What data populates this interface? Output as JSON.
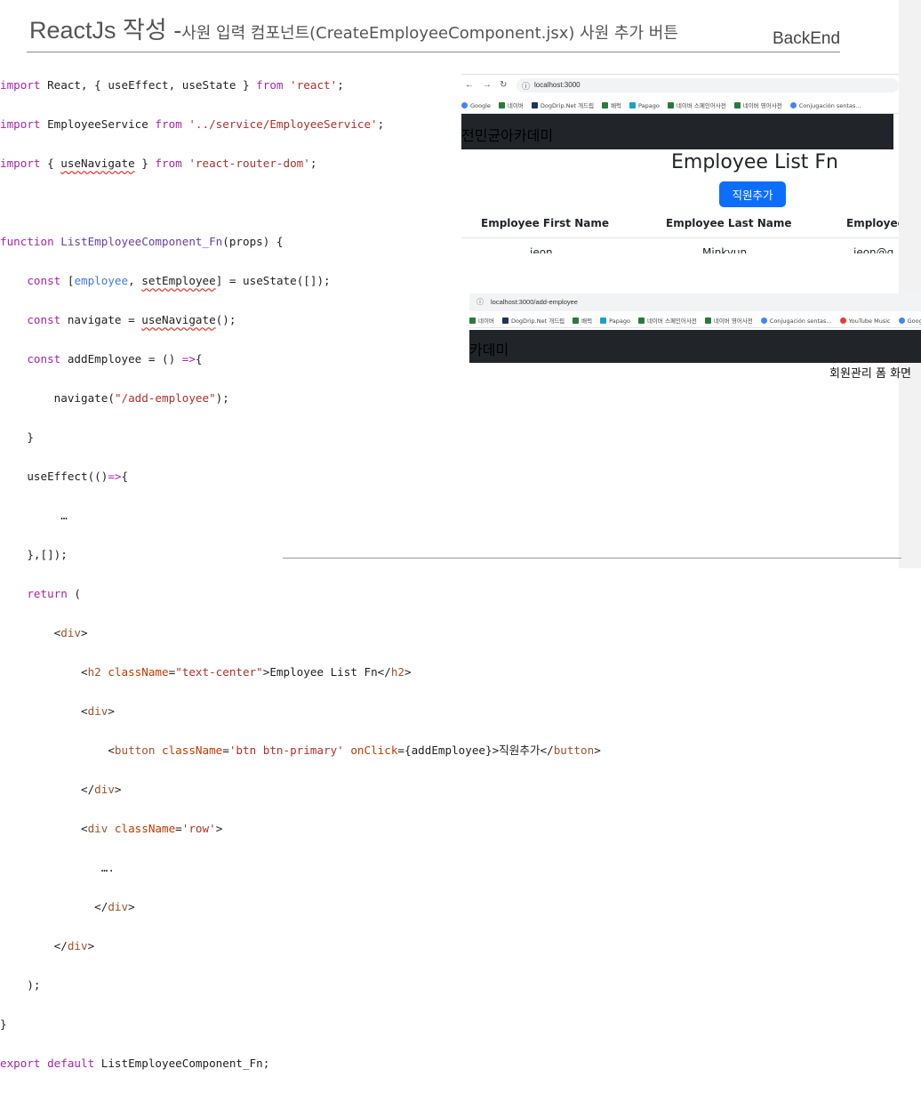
{
  "slide": {
    "title_main": "ReactJs 작성 -",
    "title_sub": "사원 입력 컴포넌트(CreateEmployeeComponent.jsx) 사원 추가 버튼",
    "section_label": "BackEnd",
    "caption": "회원관리 폼 화면"
  },
  "code": {
    "l1": {
      "a": "import",
      "b": " React, { ",
      "c": "useEffect",
      "d": ", ",
      "e": "useState",
      "f": " } ",
      "g": "from",
      "h": " ",
      "i": "'react'",
      "j": ";"
    },
    "l2": {
      "a": "import",
      "b": " EmployeeService ",
      "c": "from",
      "d": " ",
      "e": "'../service/EmployeeService'",
      "f": ";"
    },
    "l3": {
      "a": "import",
      "b": " { ",
      "c": "useNavigate",
      "d": " } ",
      "e": "from",
      "f": " ",
      "g": "'react-router-dom'",
      "h": ";"
    },
    "l5": {
      "a": "function",
      "b": " ",
      "c": "ListEmployeeComponent_Fn",
      "d": "(props) {"
    },
    "l6": {
      "a": "    ",
      "b": "const",
      "c": " [",
      "d": "employee",
      "e": ", ",
      "f": "setEmployee",
      "g": "] = ",
      "h": "useState",
      "i": "([]);"
    },
    "l7": {
      "a": "    ",
      "b": "const",
      "c": " navigate = ",
      "d": "useNavigate",
      "e": "();"
    },
    "l8": {
      "a": "    ",
      "b": "const",
      "c": " addEmployee = () ",
      "d": "=>",
      "e": "{"
    },
    "l9": {
      "a": "        ",
      "b": "navigate",
      "c": "(",
      "d": "\"/add-employee\"",
      "e": ");"
    },
    "l10": {
      "a": "    }"
    },
    "l11": {
      "a": "    ",
      "b": "useEffect",
      "c": "(()",
      "d": "=>",
      "e": "{"
    },
    "l12": {
      "a": "         …"
    },
    "l13": {
      "a": "    },[]);"
    },
    "l14": {
      "a": "    ",
      "b": "return",
      "c": " ("
    },
    "l15": {
      "a": "        <",
      "b": "div",
      "c": ">"
    },
    "l16": {
      "a": "            <",
      "b": "h2",
      "c": " ",
      "d": "className",
      "e": "=",
      "f": "\"text-center\"",
      "g": ">Employee List Fn</",
      "h": "h2",
      "i": ">"
    },
    "l17": {
      "a": "            <",
      "b": "div",
      "c": ">"
    },
    "l18": {
      "a": "                <",
      "b": "button",
      "c": " ",
      "d": "className",
      "e": "=",
      "f": "'btn btn-primary'",
      "g": " ",
      "h": "onClick",
      "i": "={addEmployee}>",
      "j": "직원추가",
      "k": "</",
      "l": "button",
      "m": ">"
    },
    "l19": {
      "a": "            </",
      "b": "div",
      "c": ">"
    },
    "l20": {
      "a": "            <",
      "b": "div",
      "c": " ",
      "d": "className",
      "e": "=",
      "f": "'row'",
      "g": ">"
    },
    "l21": {
      "a": "               ….  "
    },
    "l22": {
      "a": "              </",
      "b": "div",
      "c": ">"
    },
    "l23": {
      "a": "        </",
      "b": "div",
      "c": ">"
    },
    "l24": {
      "a": "    );"
    },
    "l25": {
      "a": "}"
    },
    "l26": {
      "a": "export",
      "b": " ",
      "c": "default",
      "d": " ListEmployeeComponent_Fn;"
    }
  },
  "shot1": {
    "back": "←",
    "forward": "→",
    "reload": "↻",
    "url": "localhost:3000",
    "bookmarks": [
      "Google",
      "네이버",
      "DogDrip.Net 개드립",
      "배럭",
      "Papago",
      "네이버 스페인어사전",
      "네이버 영어사전",
      "Conjugación sentas..."
    ],
    "navbar_brand": "전민균아카데미",
    "heading": "Employee List Fn",
    "button_label": "직원추가",
    "columns": [
      "Employee First Name",
      "Employee Last Name",
      "Employee"
    ],
    "first_row": [
      "jeon",
      "Minkyun",
      "jeon@g"
    ]
  },
  "shot2": {
    "url": "localhost:3000/add-employee",
    "bookmarks": [
      "네이버",
      "DogDrip.Net 개드립",
      "배럭",
      "Papago",
      "네이버 스페인어사전",
      "네이버 영어사전",
      "Conjugación sentas...",
      "YouTube Music",
      "Google"
    ],
    "navbar_brand": "카데미"
  }
}
